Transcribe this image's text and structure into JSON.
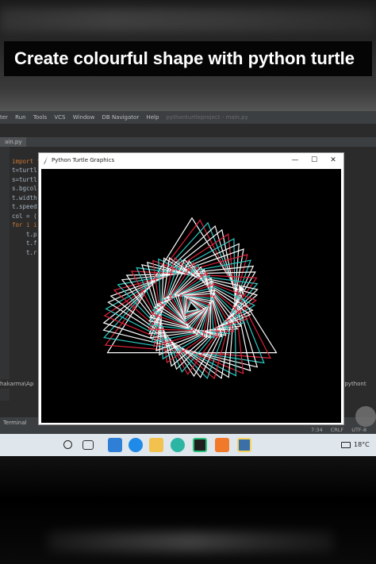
{
  "caption": "Create colourful shape with python turtle",
  "ide": {
    "menu": [
      "ter",
      "Run",
      "Tools",
      "VCS",
      "Window",
      "DB Navigator",
      "Help"
    ],
    "project_title": "pythonturtleproject - main.py",
    "file_tab": "ain.py",
    "code_lines": [
      {
        "text": "import turtle",
        "kw": true
      },
      {
        "text": "t=turtl"
      },
      {
        "text": "s=turtl"
      },
      {
        "text": "s.bgcol"
      },
      {
        "text": "t.width"
      },
      {
        "text": "t.speed"
      },
      {
        "text": "col = ("
      },
      {
        "text": "for i i",
        "kw": true
      },
      {
        "text": "t.p",
        "indent": true
      },
      {
        "text": "t.f",
        "indent": true
      },
      {
        "text": "t.r",
        "indent": true
      }
    ],
    "path_left": "hakarma\\Ap",
    "path_right": "/pythont",
    "terminal_tab": "Terminal",
    "status": [
      "7:34",
      "CRLF",
      "UTF-8"
    ]
  },
  "turtle_window": {
    "title": "Python Turtle Graphics",
    "minimize": "—",
    "maximize": "☐",
    "close": "✕",
    "line_colors": [
      "#ffffff",
      "#e0233a",
      "#2fc9c4",
      "#f5f5f5"
    ]
  },
  "taskbar": {
    "temperature": "18°C"
  }
}
